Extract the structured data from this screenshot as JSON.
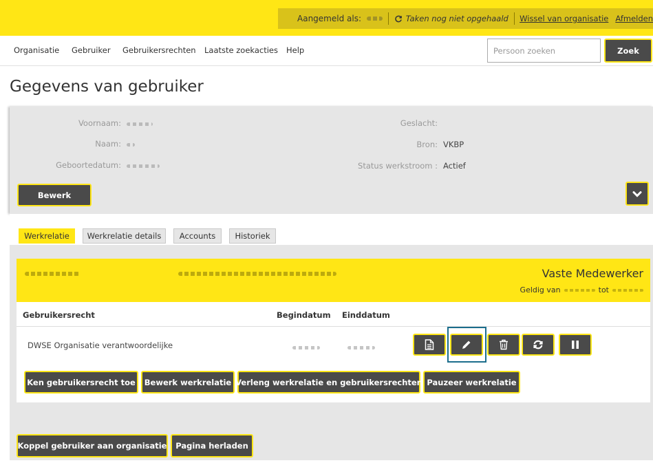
{
  "header": {
    "signed_in_label": "Aangemeld als:",
    "tasks_status": "Taken nog niet opgehaald",
    "switch_org_link": "Wissel van organisatie",
    "logout_link": "Afmelden"
  },
  "nav": {
    "items": [
      {
        "label": "Organisatie"
      },
      {
        "label": "Gebruiker"
      },
      {
        "label": "Gebruikersrechten"
      },
      {
        "label": "Laatste zoekacties"
      },
      {
        "label": "Help"
      }
    ],
    "search_placeholder": "Persoon zoeken",
    "search_button": "Zoek"
  },
  "page_title": "Gegevens van gebruiker",
  "profile": {
    "fields_left": [
      {
        "label": "Voornaam:"
      },
      {
        "label": "Naam:"
      },
      {
        "label": "Geboortedatum:"
      }
    ],
    "fields_right": [
      {
        "label": "Geslacht:",
        "value": ""
      },
      {
        "label": "Bron:",
        "value": "VKBP"
      },
      {
        "label": "Status werkstroom :",
        "value": "Actief"
      }
    ],
    "edit_button": "Bewerk"
  },
  "tabs": [
    {
      "label": "Werkrelatie",
      "active": true
    },
    {
      "label": "Werkrelatie details",
      "active": false
    },
    {
      "label": "Accounts",
      "active": false
    },
    {
      "label": "Historiek",
      "active": false
    }
  ],
  "work_relation": {
    "title": "Vaste Medewerker",
    "valid_from_label": "Geldig van",
    "valid_to_label": "tot",
    "columns": {
      "right": "Gebruikersrecht",
      "start": "Begindatum",
      "end": "Einddatum"
    },
    "rows": [
      {
        "right": "DWSE Organisatie verantwoordelijke"
      }
    ],
    "actions": [
      {
        "label": "Ken gebruikersrecht toe"
      },
      {
        "label": "Bewerk werkrelatie"
      },
      {
        "label": "Verleng werkrelatie en gebruikersrechten"
      },
      {
        "label": "Pauzeer werkrelatie"
      }
    ]
  },
  "bottom_actions": [
    {
      "label": "Koppel gebruiker aan organisatie"
    },
    {
      "label": "Pagina herladen"
    }
  ],
  "colors": {
    "brand_yellow": "#ffe615",
    "header_strip": "#d9c21a",
    "button_dark": "#4a4a4a",
    "panel_gray": "#e6e6e6",
    "focus_ring": "#1b6d8c"
  },
  "icons": [
    "refresh-icon",
    "chevron-down-icon",
    "document-icon",
    "pencil-icon",
    "trash-icon",
    "sync-icon",
    "pause-icon"
  ]
}
